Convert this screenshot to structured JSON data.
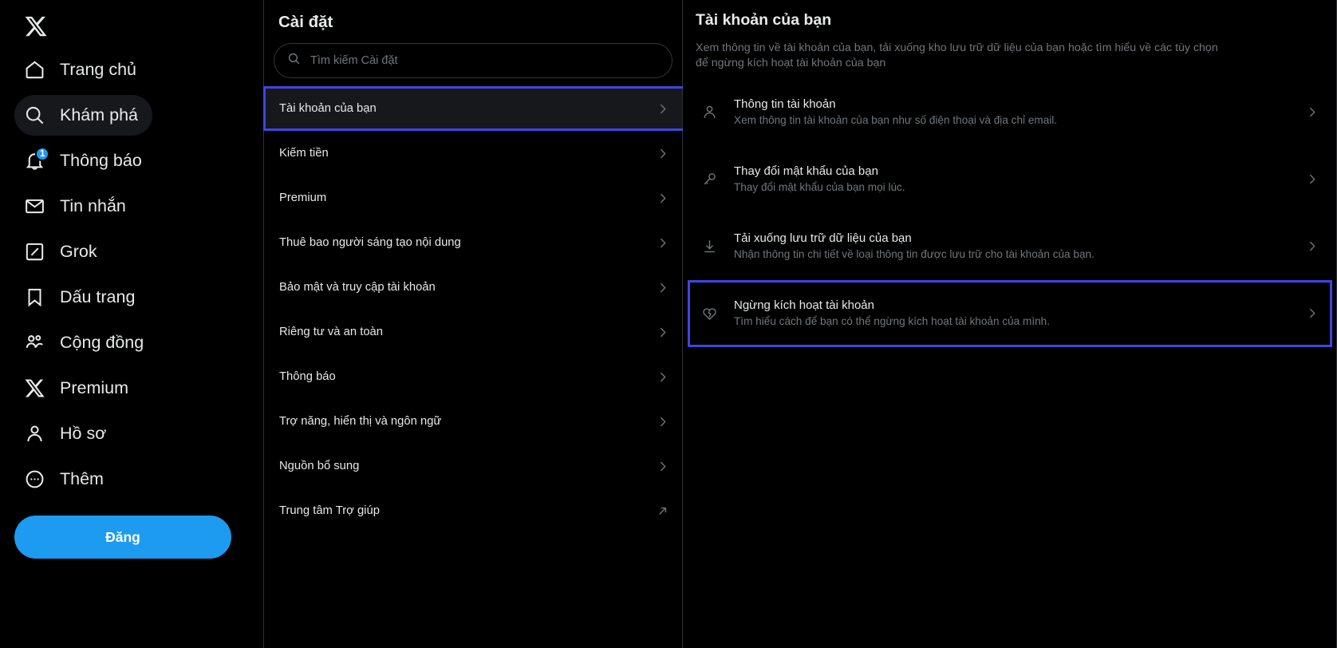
{
  "brand": {
    "logo": "x-logo",
    "accent_blue": "#1d9bf0",
    "highlight_box": "#3f45e0",
    "text": "#e7e9ea",
    "muted": "#71767b"
  },
  "sidebar": {
    "items": [
      {
        "label": "Trang chủ",
        "icon": "home-icon",
        "active": false,
        "badge": ""
      },
      {
        "label": "Khám phá",
        "icon": "search-icon",
        "active": true,
        "badge": ""
      },
      {
        "label": "Thông báo",
        "icon": "bell-icon",
        "active": false,
        "badge": "1"
      },
      {
        "label": "Tin nhắn",
        "icon": "envelope-icon",
        "active": false,
        "badge": ""
      },
      {
        "label": "Grok",
        "icon": "grok-icon",
        "active": false,
        "badge": ""
      },
      {
        "label": "Dấu trang",
        "icon": "bookmark-icon",
        "active": false,
        "badge": ""
      },
      {
        "label": "Cộng đồng",
        "icon": "community-icon",
        "active": false,
        "badge": ""
      },
      {
        "label": "Premium",
        "icon": "x-icon",
        "active": false,
        "badge": ""
      },
      {
        "label": "Hồ sơ",
        "icon": "person-icon",
        "active": false,
        "badge": ""
      },
      {
        "label": "Thêm",
        "icon": "more-circle-icon",
        "active": false,
        "badge": ""
      }
    ],
    "post_button": "Đăng"
  },
  "settings": {
    "title": "Cài đặt",
    "search_placeholder": "Tìm kiếm Cài đặt",
    "items": [
      {
        "label": "Tài khoản của bạn",
        "chevron": "chevron-right-icon",
        "selected": true
      },
      {
        "label": "Kiếm tiền",
        "chevron": "chevron-right-icon",
        "selected": false
      },
      {
        "label": "Premium",
        "chevron": "chevron-right-icon",
        "selected": false
      },
      {
        "label": "Thuê bao người sáng tạo nội dung",
        "chevron": "chevron-right-icon",
        "selected": false
      },
      {
        "label": "Bảo mật và truy cập tài khoản",
        "chevron": "chevron-right-icon",
        "selected": false
      },
      {
        "label": "Riêng tư và an toàn",
        "chevron": "chevron-right-icon",
        "selected": false
      },
      {
        "label": "Thông báo",
        "chevron": "chevron-right-icon",
        "selected": false
      },
      {
        "label": "Trợ năng, hiển thị và ngôn ngữ",
        "chevron": "chevron-right-icon",
        "selected": false
      },
      {
        "label": "Nguồn bổ sung",
        "chevron": "chevron-right-icon",
        "selected": false
      },
      {
        "label": "Trung tâm Trợ giúp",
        "chevron": "external-link-icon",
        "selected": false
      }
    ]
  },
  "detail": {
    "title": "Tài khoản của bạn",
    "description": "Xem thông tin về tài khoản của bạn, tải xuống kho lưu trữ dữ liệu của bạn hoặc tìm hiểu về các tùy chọn để ngừng kích hoạt tài khoản của bạn",
    "items": [
      {
        "icon": "person-icon",
        "title": "Thông tin tài khoản",
        "subtitle": "Xem thông tin tài khoản của bạn như số điện thoại và địa chỉ email.",
        "selected": false
      },
      {
        "icon": "key-icon",
        "title": "Thay đổi mật khẩu của bạn",
        "subtitle": "Thay đổi mật khẩu của bạn mọi lúc.",
        "selected": false
      },
      {
        "icon": "download-icon",
        "title": "Tải xuống lưu trữ dữ liệu của bạn",
        "subtitle": "Nhận thông tin chi tiết về loại thông tin được lưu trữ cho tài khoản của bạn.",
        "selected": false
      },
      {
        "icon": "broken-heart-icon",
        "title": "Ngừng kích hoạt tài khoản",
        "subtitle": "Tìm hiểu cách để bạn có thể ngừng kích hoạt tài khoản của mình.",
        "selected": true
      }
    ]
  }
}
